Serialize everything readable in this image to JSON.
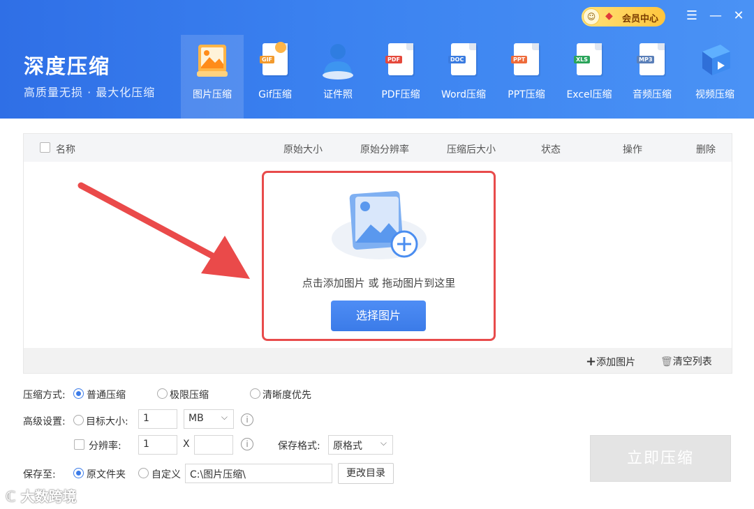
{
  "app": {
    "title": "深度压缩",
    "subtitle": "高质量无损 · 最大化压缩"
  },
  "vip": {
    "label": "会员中心"
  },
  "window_controls": {
    "menu": "☰",
    "minimize": "—",
    "close": "✕"
  },
  "tools": [
    {
      "label": "图片压缩",
      "active": true
    },
    {
      "label": "Gif压缩",
      "tag": "GIF"
    },
    {
      "label": "证件照"
    },
    {
      "label": "PDF压缩",
      "tag": "PDF"
    },
    {
      "label": "Word压缩",
      "tag": "DOC"
    },
    {
      "label": "PPT压缩",
      "tag": "PPT"
    },
    {
      "label": "Excel压缩",
      "tag": "XLS"
    },
    {
      "label": "音频压缩",
      "tag": "MP3"
    },
    {
      "label": "视频压缩"
    }
  ],
  "table": {
    "columns": [
      "名称",
      "原始大小",
      "原始分辨率",
      "压缩后大小",
      "状态",
      "操作",
      "删除"
    ],
    "drop_hint": "点击添加图片 或 拖动图片到这里",
    "select_button": "选择图片",
    "add_images": "添加图片",
    "clear_list": "清空列表"
  },
  "settings": {
    "mode_label": "压缩方式:",
    "modes": [
      "普通压缩",
      "极限压缩",
      "清晰度优先"
    ],
    "selected_mode": "普通压缩",
    "advanced_label": "高级设置:",
    "target_size_label": "目标大小:",
    "target_size_value": "1",
    "target_unit": "MB",
    "resolution_label": "分辨率:",
    "res_width": "1",
    "res_x": "X",
    "res_height": "",
    "format_label": "保存格式:",
    "format_value": "原格式",
    "save_to_label": "保存至:",
    "save_original": "原文件夹",
    "save_custom": "自定义",
    "save_path": "C:\\图片压缩\\",
    "change_dir": "更改目录",
    "compress_now": "立即压缩"
  },
  "watermark": "大数跨境",
  "colors": {
    "header": "#3b82f0",
    "accent": "#3b7be8",
    "highlight_border": "#e84b4b",
    "arrow": "#ea4a4a"
  }
}
